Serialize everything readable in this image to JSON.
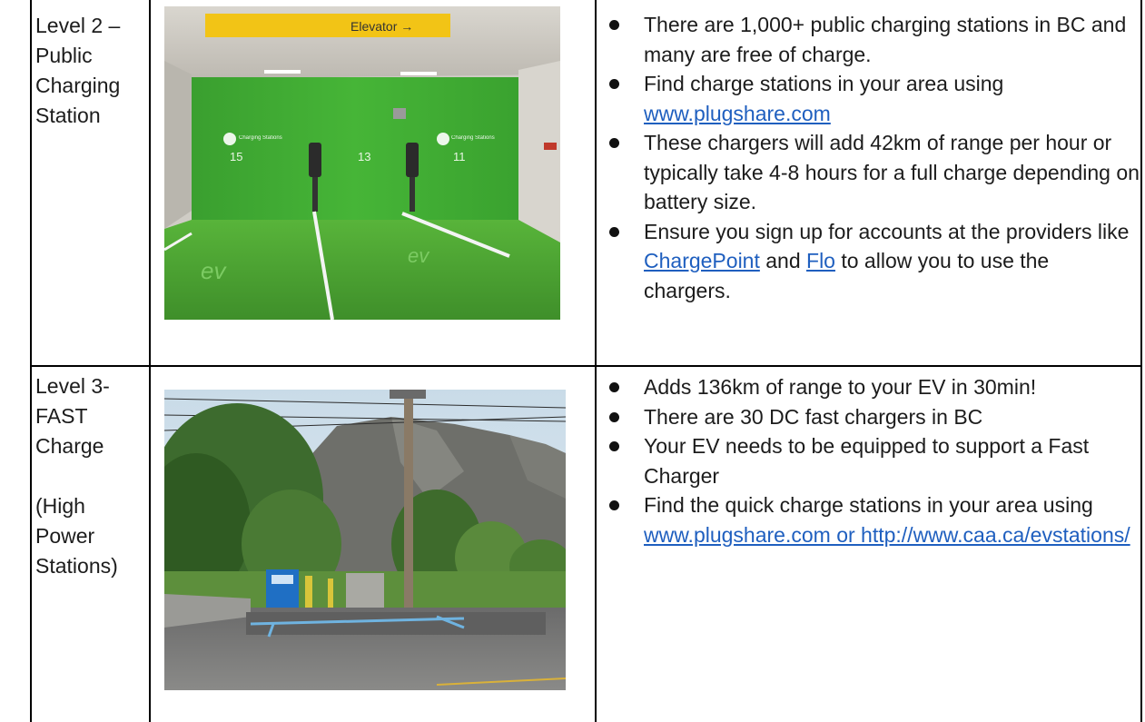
{
  "rows": [
    {
      "label": [
        "Level 2 –",
        "Public",
        "Charging",
        "Station"
      ],
      "photo": {
        "sign_text": "Elevator →",
        "bay_numbers": [
          "15",
          "13",
          "11"
        ],
        "wall_text": "Charging Stations",
        "ground_text": "ev"
      },
      "bullets": [
        {
          "parts": [
            {
              "text": "There are 1,000+ public charging stations in BC and many are free of charge."
            }
          ]
        },
        {
          "parts": [
            {
              "text": "Find charge stations in your area using "
            },
            {
              "text": "www.plugshare.com",
              "link": true
            }
          ]
        },
        {
          "parts": [
            {
              "text": "These chargers will add 42km of range per hour or typically take 4-8 hours for a full charge depending on battery size."
            }
          ]
        },
        {
          "parts": [
            {
              "text": "Ensure you sign up for accounts at the providers like "
            },
            {
              "text": "ChargePoint",
              "link": true
            },
            {
              "text": " and "
            },
            {
              "text": "Flo",
              "link": true
            },
            {
              "text": " to allow you to use the chargers."
            }
          ]
        }
      ]
    },
    {
      "label": [
        "Level 3-",
        "FAST",
        "Charge",
        "",
        "(High",
        "Power",
        "Stations)"
      ],
      "bullets": [
        {
          "parts": [
            {
              "text": "Adds 136km of range to your EV in 30min!"
            }
          ]
        },
        {
          "parts": [
            {
              "text": "There are 30 DC fast chargers in BC"
            }
          ]
        },
        {
          "parts": [
            {
              "text": "Your EV needs to be equipped to support a Fast Charger"
            }
          ]
        },
        {
          "parts": [
            {
              "text": "Find the quick charge stations in your area using "
            },
            {
              "text": "www.plugshare.com or http://www.caa.ca/evstations/",
              "link": true
            }
          ]
        }
      ]
    }
  ],
  "colors": {
    "link": "#1f5fbf",
    "grid": "#000000",
    "wall_green": "#3fae2f"
  }
}
